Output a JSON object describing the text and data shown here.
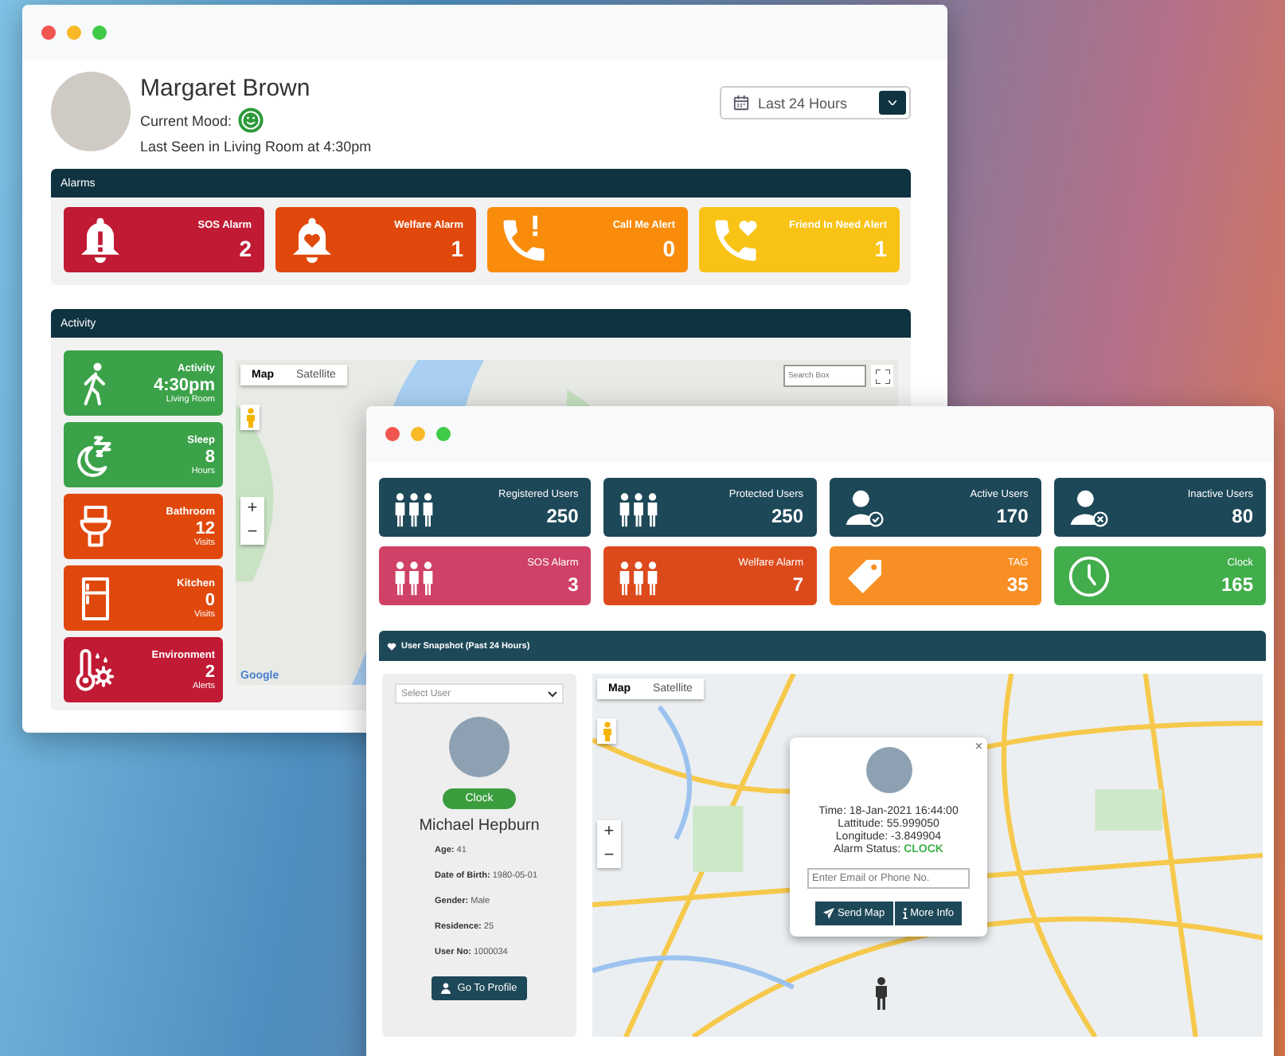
{
  "profile_window": {
    "user": {
      "name": "Margaret Brown",
      "mood_label": "Current Mood:",
      "last_seen": "Last Seen in Living Room at 4:30pm"
    },
    "period_select": {
      "value": "Last 24 Hours"
    },
    "alarms": {
      "title": "Alarms",
      "cards": [
        {
          "kind": "bell-alert",
          "label": "SOS Alarm",
          "count": "2",
          "color": "#c11a34"
        },
        {
          "kind": "bell-heart",
          "label": "Welfare Alarm",
          "count": "1",
          "color": "#e0480c"
        },
        {
          "kind": "phone-alert",
          "label": "Call Me Alert",
          "count": "0",
          "color": "#f98c0b"
        },
        {
          "kind": "phone-heart",
          "label": "Friend In Need Alert",
          "count": "1",
          "color": "#f9c316"
        }
      ]
    },
    "activity": {
      "title": "Activity",
      "tiles": [
        {
          "kind": "walk",
          "label": "Activity",
          "value": "4:30pm",
          "unit": "Living Room",
          "color": "#3ca24a"
        },
        {
          "kind": "sleep",
          "label": "Sleep",
          "value": "8",
          "unit": "Hours",
          "color": "#3ca24a"
        },
        {
          "kind": "toilet",
          "label": "Bathroom",
          "value": "12",
          "unit": "Visits",
          "color": "#e0480c"
        },
        {
          "kind": "fridge",
          "label": "Kitchen",
          "value": "0",
          "unit": "Visits",
          "color": "#e0480c"
        },
        {
          "kind": "thermometer",
          "label": "Environment",
          "value": "2",
          "unit": "Alerts",
          "color": "#c11a34"
        }
      ],
      "map": {
        "tabs": [
          {
            "label": "Map",
            "selected": true
          },
          {
            "label": "Satellite",
            "selected": false
          }
        ],
        "search": {
          "placeholder": "Search Box"
        },
        "zoom_in": "+",
        "zoom_out": "−",
        "attribution": "Google"
      }
    }
  },
  "dashboard_window": {
    "stats": [
      {
        "kind": "people",
        "label": "Registered Users",
        "count": "250",
        "color": "#1d4858"
      },
      {
        "kind": "people",
        "label": "Protected Users",
        "count": "250",
        "color": "#1d4858"
      },
      {
        "kind": "user-check",
        "label": "Active Users",
        "count": "170",
        "color": "#1d4858"
      },
      {
        "kind": "user-x",
        "label": "Inactive Users",
        "count": "80",
        "color": "#1d4858"
      },
      {
        "kind": "people",
        "label": "SOS Alarm",
        "count": "3",
        "color": "#cf4166"
      },
      {
        "kind": "people",
        "label": "Welfare Alarm",
        "count": "7",
        "color": "#dc4a1c"
      },
      {
        "kind": "tag",
        "label": "TAG",
        "count": "35",
        "color": "#f88f24"
      },
      {
        "kind": "clock",
        "label": "Clock",
        "count": "165",
        "color": "#42ad4b"
      }
    ],
    "snapshot": {
      "title": "User Snapshot (Past 24 Hours)",
      "user_select": {
        "placeholder": "Select User"
      },
      "status_badge": "Clock",
      "name": "Michael Hepburn",
      "details": [
        {
          "label": "Age:",
          "value": "41"
        },
        {
          "label": "Date of Birth:",
          "value": "1980-05-01"
        },
        {
          "label": "Gender:",
          "value": "Male"
        },
        {
          "label": "Residence:",
          "value": "25"
        },
        {
          "label": "User No:",
          "value": "1000034"
        }
      ],
      "profile_button": "Go To Profile",
      "map": {
        "tabs": [
          {
            "label": "Map",
            "selected": true
          },
          {
            "label": "Satellite",
            "selected": false
          }
        ],
        "zoom_in": "+",
        "zoom_out": "−",
        "popup": {
          "close": "×",
          "lines": [
            "Time: 18-Jan-2021 16:44:00",
            "Lattitude: 55.999050",
            "Longitude: -3.849904"
          ],
          "status_label": "Alarm Status:",
          "status_value": "CLOCK",
          "contact": {
            "placeholder": "Enter Email or Phone No."
          },
          "buttons": [
            {
              "kind": "send",
              "label": "Send Map"
            },
            {
              "kind": "info",
              "label": "More Info"
            }
          ]
        }
      }
    }
  }
}
